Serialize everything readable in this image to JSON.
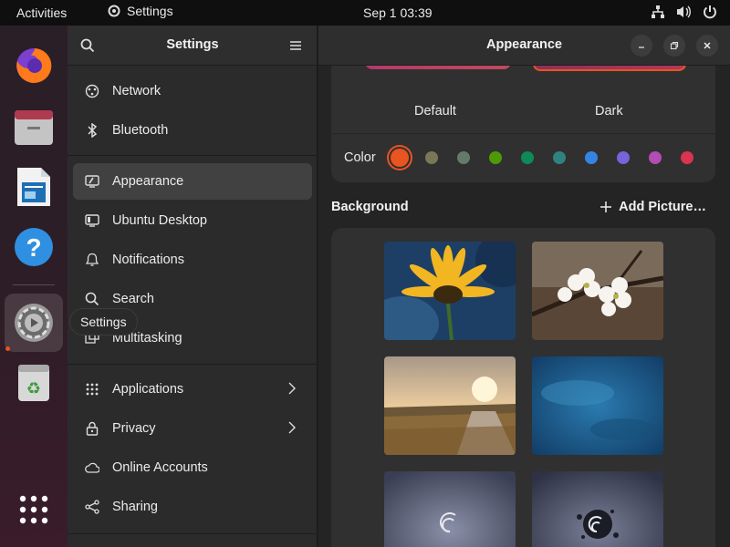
{
  "topbar": {
    "activities": "Activities",
    "app_name": "Settings",
    "clock": "Sep 1  03:39",
    "icons": [
      "network-wired-icon",
      "volume-icon",
      "power-icon"
    ]
  },
  "dock": {
    "items": [
      "firefox-icon",
      "files-icon",
      "libreoffice-writer-icon",
      "help-icon",
      "settings-icon",
      "trash-icon",
      "app-grid-icon"
    ],
    "tooltip": "Settings"
  },
  "sidebar": {
    "title": "Settings",
    "items": [
      {
        "label": "Network",
        "icon": "network-icon"
      },
      {
        "label": "Bluetooth",
        "icon": "bluetooth-icon"
      },
      {
        "label": "Appearance",
        "icon": "appearance-icon",
        "selected": true
      },
      {
        "label": "Ubuntu Desktop",
        "icon": "ubuntu-desktop-icon"
      },
      {
        "label": "Notifications",
        "icon": "bell-icon"
      },
      {
        "label": "Search",
        "icon": "search-icon"
      },
      {
        "label": "Multitasking",
        "icon": "multitasking-icon"
      },
      {
        "label": "Applications",
        "icon": "apps-icon",
        "chevron": true
      },
      {
        "label": "Privacy",
        "icon": "lock-icon",
        "chevron": true
      },
      {
        "label": "Online Accounts",
        "icon": "cloud-icon"
      },
      {
        "label": "Sharing",
        "icon": "share-icon"
      }
    ]
  },
  "main": {
    "title": "Appearance",
    "styles": {
      "default": "Default",
      "dark": "Dark",
      "selected": "Dark"
    },
    "color_label": "Color",
    "accent_colors": [
      "#e95420",
      "#787859",
      "#657b69",
      "#4e9a06",
      "#0e8a58",
      "#308280",
      "#3584e4",
      "#7764d8",
      "#b34cb3",
      "#da3450"
    ],
    "selected_accent": "#e95420",
    "background_title": "Background",
    "add_picture": "Add Picture…"
  }
}
